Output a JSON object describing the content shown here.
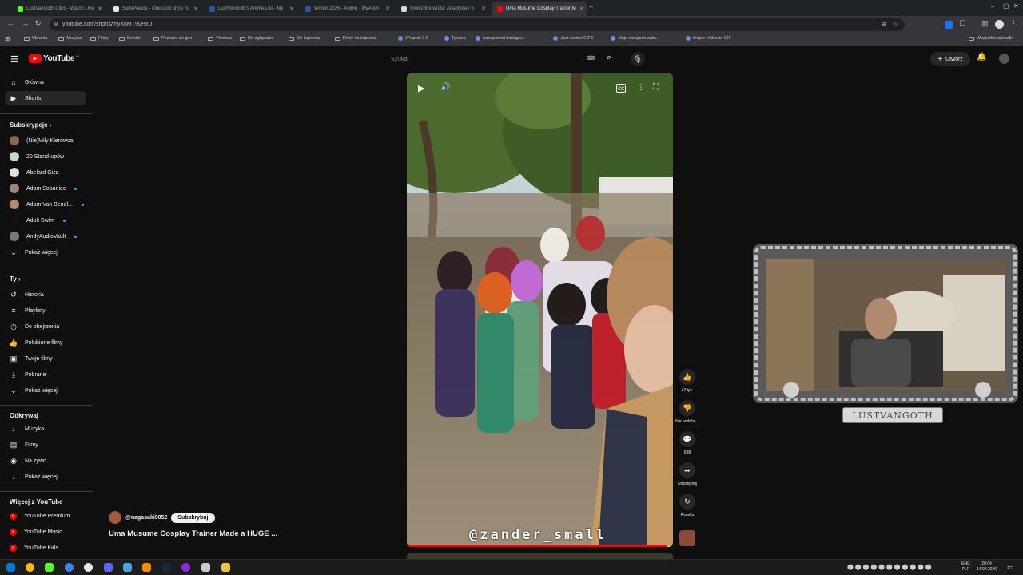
{
  "browser": {
    "tabs": [
      {
        "title": "LustVanGoth Clips - Watch Live",
        "color": "#53fc18",
        "active": false
      },
      {
        "title": "SuitsPleace - One stop shop fo",
        "color": "#e8eaed",
        "active": false
      },
      {
        "title": "LustVanGoth's Anime List - My",
        "color": "#2e51a2",
        "active": false
      },
      {
        "title": "Winter 2026 - Anime - MyAnim",
        "color": "#2e51a2",
        "active": false
      },
      {
        "title": "Gwiezdne wrota: Atlantyda / S",
        "color": "#d9d9d9",
        "active": false
      },
      {
        "title": "Uma Musume Cosplay Trainer M",
        "color": "#ff0000",
        "active": true
      }
    ],
    "new_tab": "+",
    "url": "youtube.com/shorts/myXnMT90HxU",
    "bookmarks": [
      {
        "label": "Ubrania",
        "type": "folder"
      },
      {
        "label": "Muzyka",
        "type": "folder"
      },
      {
        "label": "Filmy",
        "type": "folder"
      },
      {
        "label": "Seriale",
        "type": "folder"
      },
      {
        "label": "Pomoce do gier",
        "type": "folder"
      },
      {
        "label": "Pomoce",
        "type": "folder"
      },
      {
        "label": "Do oglądania",
        "type": "folder"
      },
      {
        "label": "Do kupienia",
        "type": "folder"
      },
      {
        "label": "Filmy do kupienia",
        "type": "folder"
      },
      {
        "label": "JPopuki 2.0",
        "type": "site"
      },
      {
        "label": "Tpexep",
        "type": "site"
      },
      {
        "label": "transparent backgro...",
        "type": "site"
      },
      {
        "label": "Just Anime GIFS",
        "type": "site"
      },
      {
        "label": "Moje wstępnie zalw...",
        "type": "site"
      },
      {
        "label": "Imgur: Video to GIF",
        "type": "site"
      }
    ],
    "all_bookmarks": "Wszystkie zakładki"
  },
  "youtube": {
    "logo_text": "YouTube",
    "logo_region": "PL",
    "search_placeholder": "Szukaj",
    "create_label": "Utwórz",
    "sidebar": {
      "main": [
        {
          "label": "Główna",
          "icon": "home-icon"
        },
        {
          "label": "Shorts",
          "icon": "shorts-icon",
          "active": true
        }
      ],
      "subscriptions_title": "Subskrypcje",
      "subscriptions": [
        {
          "label": "(Nie)Miły Kierowca",
          "color": "#8a6a4a",
          "dot": false
        },
        {
          "label": "20 Stand-upów",
          "color": "#d0d0d0",
          "dot": false
        },
        {
          "label": "Abelard Giza",
          "color": "#e0e0e0",
          "dot": false
        },
        {
          "label": "Adam Sobaniec",
          "color": "#9a8a7a",
          "dot": true
        },
        {
          "label": "Adam Van Bendl...",
          "color": "#b08a6a",
          "dot": true
        },
        {
          "label": "Adult Swim",
          "color": "#111111",
          "dot": true
        },
        {
          "label": "AndyAudioVault",
          "color": "#7a7a7a",
          "dot": true
        }
      ],
      "show_more": "Pokaż więcej",
      "you_title": "Ty",
      "you": [
        {
          "label": "Historia",
          "icon": "history-icon"
        },
        {
          "label": "Playlisty",
          "icon": "playlist-icon"
        },
        {
          "label": "Do obejrzenia",
          "icon": "watch-later-icon"
        },
        {
          "label": "Polubione filmy",
          "icon": "liked-icon"
        },
        {
          "label": "Twoje filmy",
          "icon": "your-videos-icon"
        },
        {
          "label": "Pobrane",
          "icon": "download-icon"
        }
      ],
      "explore_title": "Odkrywaj",
      "explore": [
        {
          "label": "Muzyka",
          "icon": "music-icon"
        },
        {
          "label": "Filmy",
          "icon": "film-icon"
        },
        {
          "label": "Na żywo",
          "icon": "live-icon"
        }
      ],
      "more_title": "Więcej z YouTube",
      "more": [
        {
          "label": "YouTube Premium"
        },
        {
          "label": "YouTube Music"
        },
        {
          "label": "YouTube Kids"
        }
      ]
    },
    "short": {
      "channel": "@nagasaki9052",
      "subscribe_label": "Subskrybuj",
      "title": "Uma Musume Cosplay Trainer Made a HUGE ...",
      "watermark": "@zander_small",
      "progress": 0.98,
      "likes": "42 tys.",
      "dislike_label": "Nie podoba...",
      "comments": "698",
      "share_label": "Udostępnij",
      "remix_label": "Remiks"
    }
  },
  "overlay": {
    "streamer_name": "LUSTVANGOTH"
  },
  "taskbar": {
    "lang": "ENG",
    "lang2": "PLP",
    "time": "20:04",
    "date": "14.03.2026"
  }
}
